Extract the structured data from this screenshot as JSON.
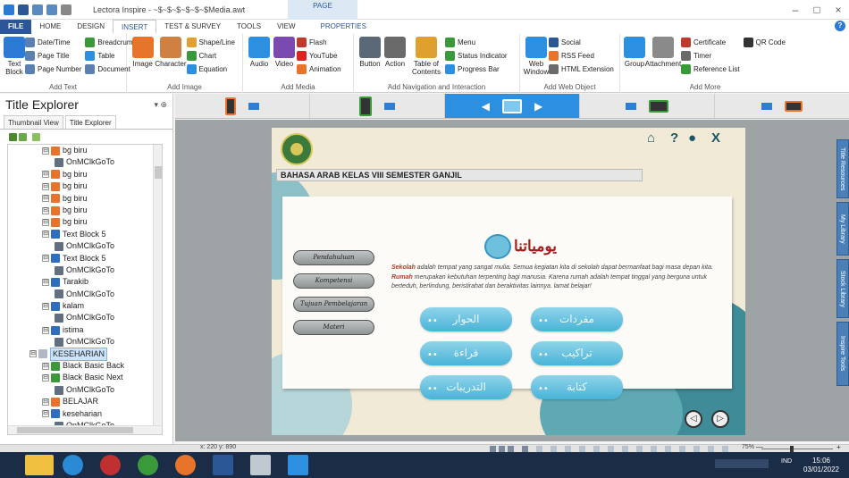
{
  "window": {
    "title": "Lectora Inspire - ~$~$~$~$~$~$Media.awt",
    "context_group": "PAGE",
    "minimize": "–",
    "restore": "□",
    "close": "×"
  },
  "tabs": [
    "FILE",
    "HOME",
    "DESIGN",
    "INSERT",
    "TEST & SURVEY",
    "TOOLS",
    "VIEW",
    "PROPERTIES"
  ],
  "active_tab": "INSERT",
  "ribbon": {
    "add_text": {
      "label": "Add Text",
      "text_block": "Text Block",
      "date_time": "Date/Time",
      "page_title": "Page Title",
      "page_number": "Page Number",
      "breadcrumb": "Breadcrumb",
      "table": "Table",
      "document": "Document"
    },
    "add_image": {
      "label": "Add Image",
      "image": "Image",
      "character": "Character",
      "shape_line": "Shape/Line",
      "chart": "Chart",
      "equation": "Equation"
    },
    "add_media": {
      "label": "Add Media",
      "audio": "Audio",
      "video": "Video",
      "flash": "Flash",
      "youtube": "YouTube",
      "animation": "Animation"
    },
    "add_navigation": {
      "label": "Add Navigation and Interaction",
      "button": "Button",
      "action": "Action",
      "table_of_contents": "Table of Contents",
      "menu": "Menu",
      "status_indicator": "Status Indicator",
      "progress_bar": "Progress Bar"
    },
    "add_web_object": {
      "label": "Add Web Object",
      "web_window": "Web Window",
      "social": "Social",
      "rss_feed": "RSS Feed",
      "html_extension": "HTML Extension"
    },
    "add_more": {
      "label": "Add More",
      "group": "Group",
      "attachment": "Attachment",
      "certificate": "Certificate",
      "timer": "Timer",
      "reference_list": "Reference List",
      "qr_code": "QR Code"
    }
  },
  "panel": {
    "title": "Title Explorer",
    "pin": "▾ ⊕",
    "tabs": [
      "Thumbnail View",
      "Title Explorer"
    ],
    "active_tab": "Title Explorer",
    "tree": [
      {
        "label": "bg biru",
        "depth": 3,
        "icon": "image",
        "color": "#e8742c"
      },
      {
        "label": "OnMClkGoTo",
        "depth": 4,
        "icon": "action",
        "color": "#607080"
      },
      {
        "label": "bg biru",
        "depth": 3,
        "icon": "image",
        "color": "#e8742c"
      },
      {
        "label": "bg biru",
        "depth": 3,
        "icon": "image",
        "color": "#e8742c"
      },
      {
        "label": "bg biru",
        "depth": 3,
        "icon": "image",
        "color": "#e8742c"
      },
      {
        "label": "bg biru",
        "depth": 3,
        "icon": "image",
        "color": "#e8742c"
      },
      {
        "label": "bg biru",
        "depth": 3,
        "icon": "image",
        "color": "#e8742c"
      },
      {
        "label": "Text Block 5",
        "depth": 3,
        "icon": "text",
        "color": "#2c6fc0"
      },
      {
        "label": "OnMClkGoTo",
        "depth": 4,
        "icon": "action",
        "color": "#607080"
      },
      {
        "label": "Text Block 5",
        "depth": 3,
        "icon": "text",
        "color": "#2c6fc0"
      },
      {
        "label": "OnMClkGoTo",
        "depth": 4,
        "icon": "action",
        "color": "#607080"
      },
      {
        "label": "Tarakib",
        "depth": 3,
        "icon": "text",
        "color": "#2c6fc0"
      },
      {
        "label": "OnMClkGoTo",
        "depth": 4,
        "icon": "action",
        "color": "#607080"
      },
      {
        "label": "kalam",
        "depth": 3,
        "icon": "text",
        "color": "#2c6fc0"
      },
      {
        "label": "OnMClkGoTo",
        "depth": 4,
        "icon": "action",
        "color": "#607080"
      },
      {
        "label": "istima",
        "depth": 3,
        "icon": "text",
        "color": "#2c6fc0"
      },
      {
        "label": "OnMClkGoTo",
        "depth": 4,
        "icon": "action",
        "color": "#607080"
      },
      {
        "label": "KESEHARIAN",
        "depth": 2,
        "icon": "page",
        "color": "#b0b8c8",
        "selected": true
      },
      {
        "label": "Black Basic Back",
        "depth": 3,
        "icon": "button",
        "color": "#3a9a3a"
      },
      {
        "label": "Black Basic Next",
        "depth": 3,
        "icon": "button",
        "color": "#3a9a3a"
      },
      {
        "label": "OnMClkGoTo",
        "depth": 4,
        "icon": "action",
        "color": "#607080"
      },
      {
        "label": "BELAJAR",
        "depth": 3,
        "icon": "image",
        "color": "#e8742c"
      },
      {
        "label": "keseharian",
        "depth": 3,
        "icon": "text",
        "color": "#2c6fc0"
      },
      {
        "label": "OnMClkGoTo",
        "depth": 4,
        "icon": "action",
        "color": "#607080"
      }
    ]
  },
  "slide": {
    "banner": "BAHASA ARAB KELAS VIII SEMESTER GANJIL",
    "nav_icons": [
      "home-icon",
      "help-icon",
      "profile-icon",
      "exit-icon"
    ],
    "nav_home": "⌂",
    "nav_help": "?",
    "nav_profile": "●",
    "nav_exit": "X",
    "heading": "يومياتنا",
    "body": {
      "kw1": "Sekolah",
      "t1": " adalah tempat yang sangat mulia. Semua kegiatan kita di sekolah dapat bermanfaat bagi masa depan kita. ",
      "kw2": "Rumah",
      "t2": " merupakan kebutuhan terpenting bagi manusia. Karena rumah adalah tempat tinggal yang berguna untuk berteduh, berlindung, beristirahat dan beraktivitas lainnya. lamat belajar!"
    },
    "side_buttons": [
      "Pendahuluan",
      "Kompetensi",
      "Tujuan Pembelajaran",
      "Materi"
    ],
    "arabic_buttons": [
      {
        "label": "الحوار",
        "col": 0,
        "row": 0
      },
      {
        "label": "مفردات",
        "col": 1,
        "row": 0
      },
      {
        "label": "قراءة",
        "col": 0,
        "row": 1
      },
      {
        "label": "تراكيب",
        "col": 1,
        "row": 1
      },
      {
        "label": "التدريبات",
        "col": 0,
        "row": 2
      },
      {
        "label": "كتابة",
        "col": 1,
        "row": 2
      }
    ],
    "prev": "◁",
    "next": "▷"
  },
  "side_tabs": [
    "Title Resources",
    "My Library",
    "Stock Library",
    "Inspire Tools"
  ],
  "status": {
    "coords": "x: 220 y: 890",
    "zoom": "75%",
    "minus": "—",
    "plus": "+"
  },
  "taskbar": {
    "apps": [
      "file-explorer",
      "internet-explorer",
      "media-app",
      "chrome",
      "firefox",
      "word",
      "paint-app",
      "lectora"
    ],
    "tray": "IND",
    "time": "15:06",
    "date": "03/01/2022"
  },
  "colors": {
    "accent": "#2b5797",
    "selected_device": "#2c8fe0",
    "slide_button": "#49b3d7",
    "heading": "#a41e1e"
  }
}
